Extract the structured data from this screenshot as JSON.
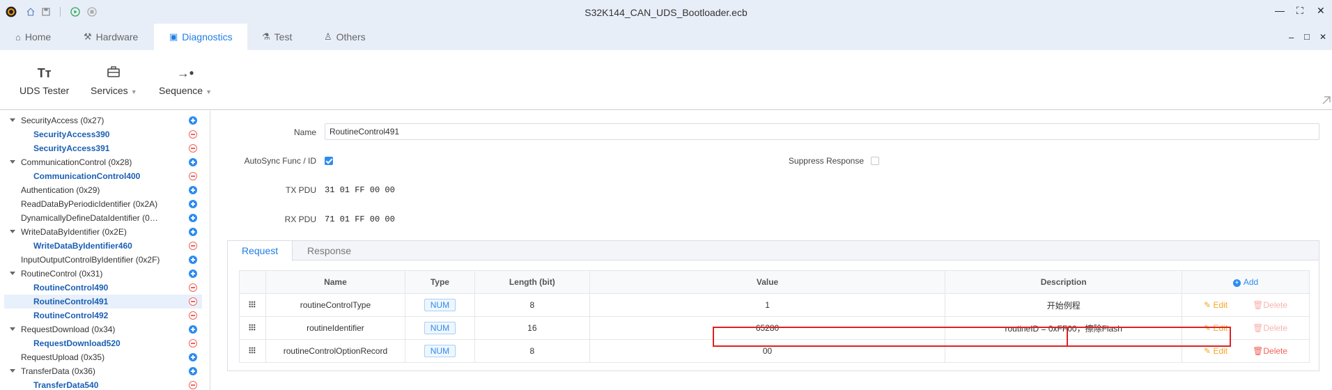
{
  "window": {
    "title": "S32K144_CAN_UDS_Bootloader.ecb",
    "controls": {
      "minimize": "—",
      "maximize": "⛶",
      "close": "✕"
    },
    "inner_controls": {
      "minimize": "–",
      "maximize": "□",
      "close": "✕"
    }
  },
  "menu_tabs": [
    {
      "label": "Home",
      "icon": "home-outline-icon"
    },
    {
      "label": "Hardware",
      "icon": "hammer-icon"
    },
    {
      "label": "Diagnostics",
      "icon": "diagnostics-icon",
      "active": true
    },
    {
      "label": "Test",
      "icon": "flask-icon"
    },
    {
      "label": "Others",
      "icon": "user-icon"
    }
  ],
  "ribbon": {
    "uds_tester": "UDS Tester",
    "services": "Services",
    "sequence": "Sequence"
  },
  "tree": [
    {
      "label": "SecurityAccess (0x27)",
      "level": 0,
      "expanded": true,
      "action": "add"
    },
    {
      "label": "SecurityAccess390",
      "level": 1,
      "action": "remove"
    },
    {
      "label": "SecurityAccess391",
      "level": 1,
      "action": "remove"
    },
    {
      "label": "CommunicationControl (0x28)",
      "level": 0,
      "expanded": true,
      "action": "add"
    },
    {
      "label": "CommunicationControl400",
      "level": 1,
      "action": "remove"
    },
    {
      "label": "Authentication (0x29)",
      "level": 0,
      "action": "add"
    },
    {
      "label": "ReadDataByPeriodicIdentifier (0x2A)",
      "level": 0,
      "action": "add"
    },
    {
      "label": "DynamicallyDefineDataIdentifier (0…",
      "level": 0,
      "action": "add"
    },
    {
      "label": "WriteDataByIdentifier (0x2E)",
      "level": 0,
      "expanded": true,
      "action": "add"
    },
    {
      "label": "WriteDataByIdentifier460",
      "level": 1,
      "action": "remove"
    },
    {
      "label": "InputOutputControlByIdentifier (0x2F)",
      "level": 0,
      "action": "add"
    },
    {
      "label": "RoutineControl (0x31)",
      "level": 0,
      "expanded": true,
      "action": "add"
    },
    {
      "label": "RoutineControl490",
      "level": 1,
      "action": "remove"
    },
    {
      "label": "RoutineControl491",
      "level": 1,
      "action": "remove",
      "selected": true
    },
    {
      "label": "RoutineControl492",
      "level": 1,
      "action": "remove"
    },
    {
      "label": "RequestDownload (0x34)",
      "level": 0,
      "expanded": true,
      "action": "add"
    },
    {
      "label": "RequestDownload520",
      "level": 1,
      "action": "remove"
    },
    {
      "label": "RequestUpload (0x35)",
      "level": 0,
      "action": "add"
    },
    {
      "label": "TransferData (0x36)",
      "level": 0,
      "expanded": true,
      "action": "add"
    },
    {
      "label": "TransferData540",
      "level": 1,
      "action": "remove"
    }
  ],
  "form": {
    "name_label": "Name",
    "name_value": "RoutineControl491",
    "autosync_label": "AutoSync Func / ID",
    "autosync_checked": true,
    "suppress_label": "Suppress Response",
    "suppress_checked": false,
    "tx_label": "TX PDU",
    "tx_value": "31 01 FF 00 00",
    "rx_label": "RX PDU",
    "rx_value": "71 01 FF 00 00"
  },
  "panel": {
    "tabs": [
      "Request",
      "Response"
    ],
    "active_tab": "Request",
    "columns": [
      "Name",
      "Type",
      "Length (bit)",
      "Value",
      "Description"
    ],
    "add_label": "Add",
    "edit_label": "Edit",
    "delete_label": "Delete",
    "rows": [
      {
        "name": "routineControlType",
        "type": "NUM",
        "length": "8",
        "value": "1",
        "description": "开始例程",
        "delete_enabled": false
      },
      {
        "name": "routineIdentifier",
        "type": "NUM",
        "length": "16",
        "value": "65280",
        "description": "routineID = 0xFF00，擦除Flash",
        "delete_enabled": false,
        "highlighted": true
      },
      {
        "name": "routineControlOptionRecord",
        "type": "NUM",
        "length": "8",
        "value": "00",
        "description": "",
        "delete_enabled": true
      }
    ]
  },
  "colors": {
    "accent": "#1e7ee6",
    "highlight_border": "#e02020",
    "delete": "#f0625a",
    "edit": "#f5a623"
  }
}
